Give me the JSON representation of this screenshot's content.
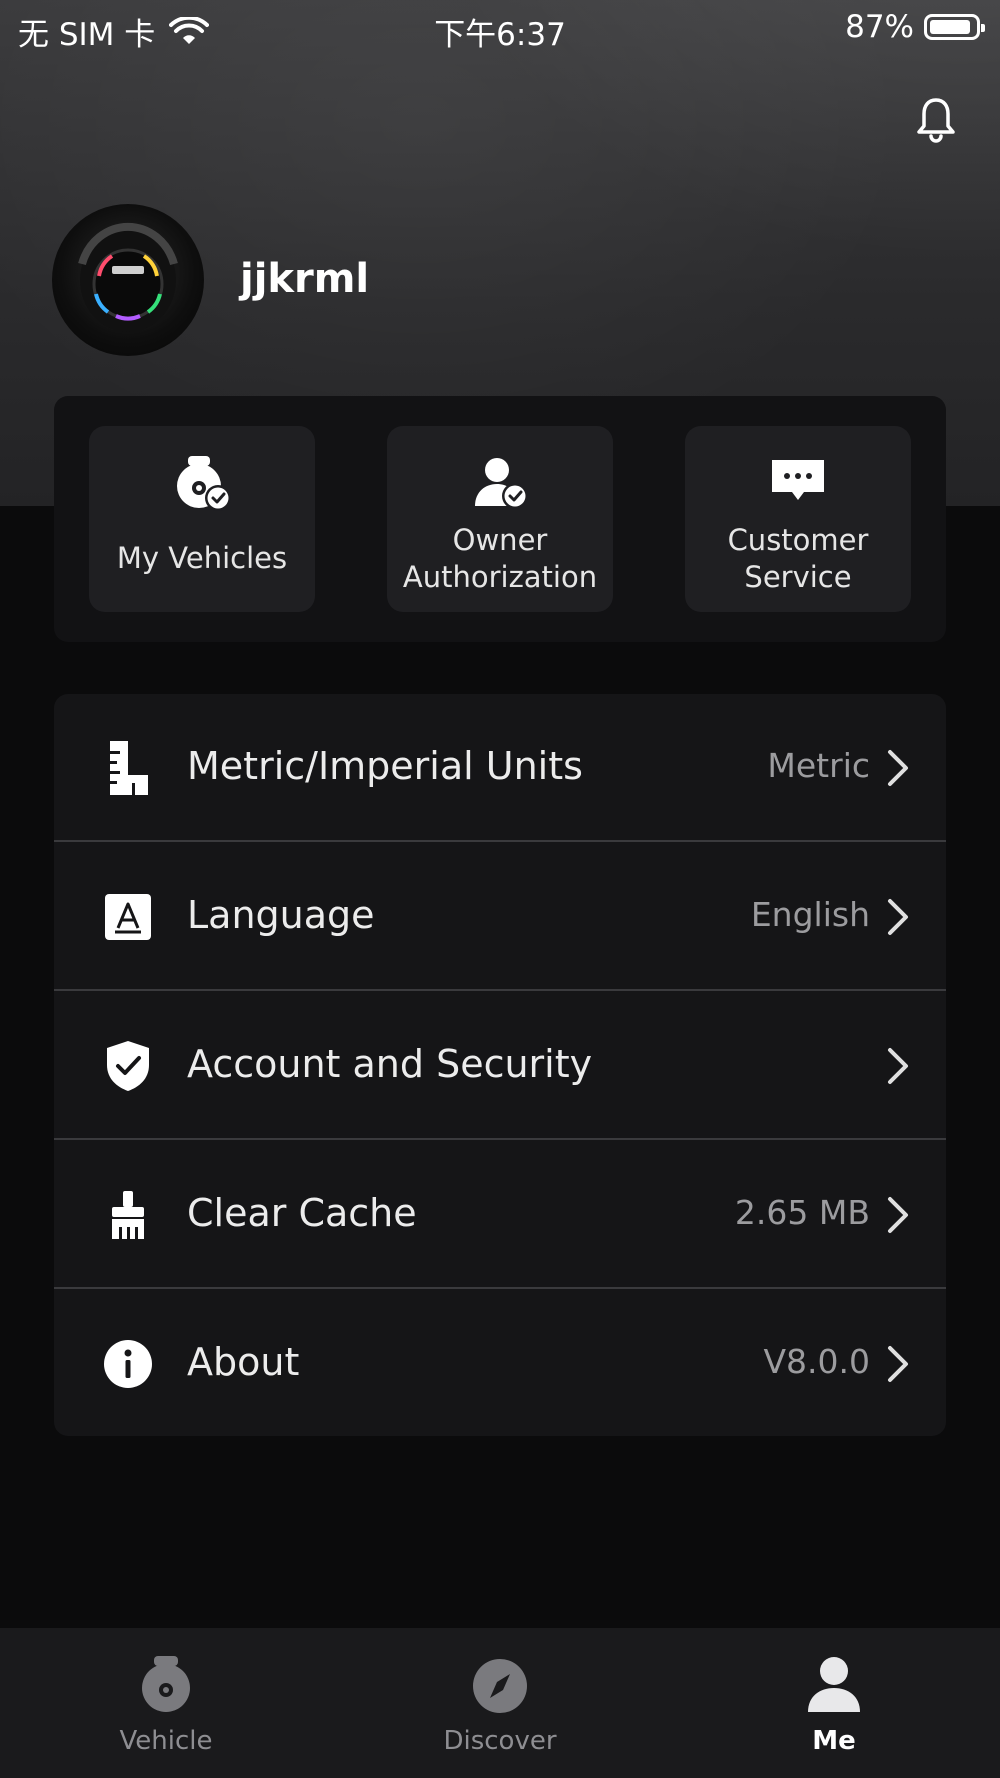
{
  "status_bar": {
    "carrier": "无 SIM 卡",
    "time": "下午6:37",
    "battery": "87%",
    "battery_level": 0.87
  },
  "header": {
    "notification_icon": "bell-icon"
  },
  "profile": {
    "username": "jjkrml",
    "avatar": "vehicle-avatar"
  },
  "quick_actions": [
    {
      "label": "My Vehicles",
      "icon": "vehicle-check-icon"
    },
    {
      "label": "Owner Authorization",
      "icon": "user-check-icon"
    },
    {
      "label": "Customer Service",
      "icon": "chat-bubble-icon"
    }
  ],
  "settings": [
    {
      "label": "Metric/Imperial Units",
      "value": "Metric",
      "icon": "ruler-icon"
    },
    {
      "label": "Language",
      "value": "English",
      "icon": "language-icon"
    },
    {
      "label": "Account and Security",
      "value": "",
      "icon": "shield-check-icon"
    },
    {
      "label": "Clear Cache",
      "value": "2.65 MB",
      "icon": "broom-icon"
    },
    {
      "label": "About",
      "value": "V8.0.0",
      "icon": "info-icon"
    }
  ],
  "tabbar": {
    "tabs": [
      {
        "label": "Vehicle",
        "icon": "wheel-icon",
        "active": false
      },
      {
        "label": "Discover",
        "icon": "compass-icon",
        "active": false
      },
      {
        "label": "Me",
        "icon": "person-icon",
        "active": true
      }
    ]
  },
  "colors": {
    "background": "#0b0b0c",
    "card": "#151517",
    "tile": "#1f1f22",
    "muted_text": "#9c9c9f"
  }
}
